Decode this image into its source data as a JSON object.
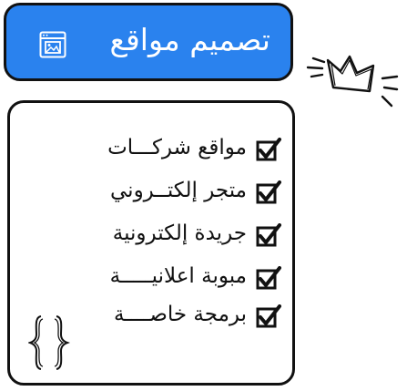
{
  "header": {
    "title": "تصميم مواقع",
    "icon": "browser-window-icon",
    "background_color": "#2a82ee"
  },
  "services": {
    "items": [
      {
        "label": "مواقع شركـــات",
        "icon": "checkbox-checked-icon"
      },
      {
        "label": "متجر إلكتــروني",
        "icon": "checkbox-checked-icon"
      },
      {
        "label": "جريدة إلكترونية",
        "icon": "checkbox-checked-icon"
      },
      {
        "label": "مبوبة اعلانيـــــة",
        "icon": "checkbox-checked-icon"
      },
      {
        "label": "برمجة خاصــــة",
        "icon": "checkbox-checked-icon"
      }
    ]
  },
  "decorations": {
    "braces_icon": "curly-braces-icon",
    "crown_icon": "crown-doodle-icon"
  }
}
